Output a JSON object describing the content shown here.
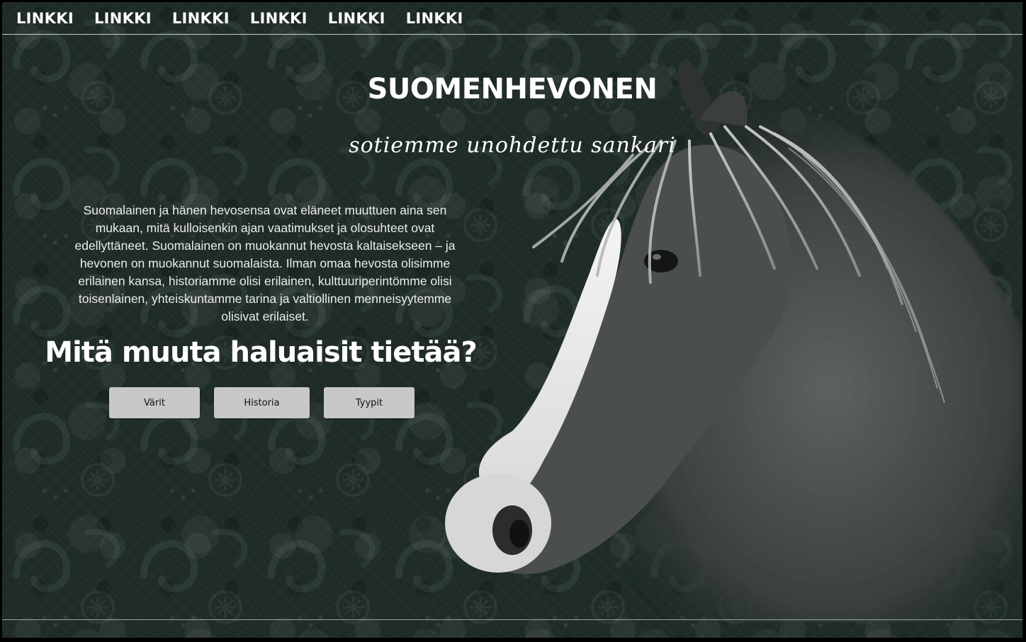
{
  "nav": {
    "links": [
      "LINKKI",
      "LINKKI",
      "LINKKI",
      "LINKKI",
      "LINKKI",
      "LINKKI"
    ]
  },
  "hero": {
    "title": "SUOMENHEVONEN",
    "subtitle": "sotiemme unohdettu sankari"
  },
  "intro": {
    "text": "Suomalainen ja hänen hevosensa ovat eläneet muuttuen aina sen mukaan, mitä kulloisenkin ajan vaatimukset ja olosuhteet ovat edellyttäneet. Suomalainen on muokannut hevosta kaltaisekseen – ja hevonen on muokannut suomalaista. Ilman omaa hevosta olisimme erilainen kansa, historiamme olisi erilainen, kulttuuriperintömme olisi toisenlainen, yhteiskuntamme tarina ja valtiollinen menneisyytemme olisivat erilaiset."
  },
  "more": {
    "question": "Mitä muuta haluaisit tietää?",
    "buttons": {
      "varit": "Värit",
      "historia": "Historia",
      "tyypit": "Tyypit"
    }
  },
  "colors": {
    "background": "#1f2b27",
    "button": "#c8c8c8",
    "text": "#ffffff"
  },
  "icons": {
    "hero_image": "horse-portrait-image"
  }
}
